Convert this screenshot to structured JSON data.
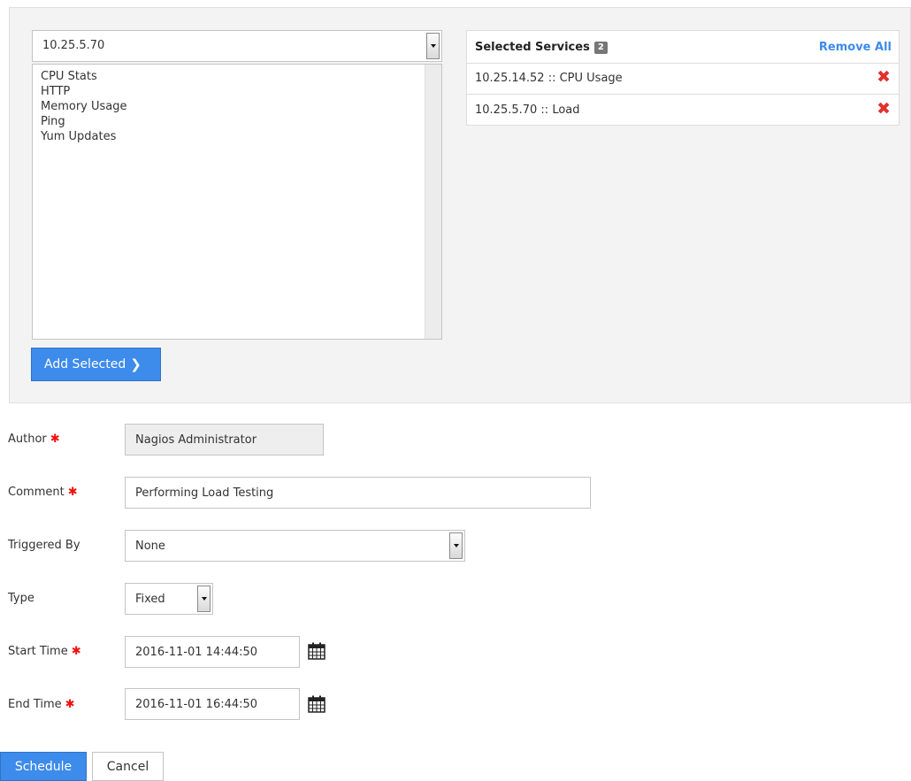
{
  "host_select": {
    "value": "10.25.5.70"
  },
  "service_list": [
    "CPU Stats",
    "HTTP",
    "Memory Usage",
    "Ping",
    "Yum Updates"
  ],
  "add_selected": {
    "label": "Add Selected",
    "chevron": "❯"
  },
  "selected_services": {
    "title": "Selected Services",
    "count": "2",
    "remove_all": "Remove All",
    "items": [
      "10.25.14.52 :: CPU Usage",
      "10.25.5.70 :: Load"
    ],
    "remove_glyph": "✖"
  },
  "form": {
    "required_mark": "✱",
    "author": {
      "label": "Author",
      "value": "Nagios Administrator"
    },
    "comment": {
      "label": "Comment",
      "value": "Performing Load Testing"
    },
    "triggered_by": {
      "label": "Triggered By",
      "value": "None"
    },
    "type": {
      "label": "Type",
      "value": "Fixed"
    },
    "start_time": {
      "label": "Start Time",
      "value": "2016-11-01 14:44:50"
    },
    "end_time": {
      "label": "End Time",
      "value": "2016-11-01 16:44:50"
    }
  },
  "buttons": {
    "schedule": "Schedule",
    "cancel": "Cancel"
  },
  "colors": {
    "accent": "#3d8bea",
    "required": "#ee1111",
    "remove": "#e0322d"
  },
  "icons": {
    "calendar": "calendar-icon",
    "remove": "close-icon",
    "dropdown": "dropdown-arrow-icon"
  }
}
